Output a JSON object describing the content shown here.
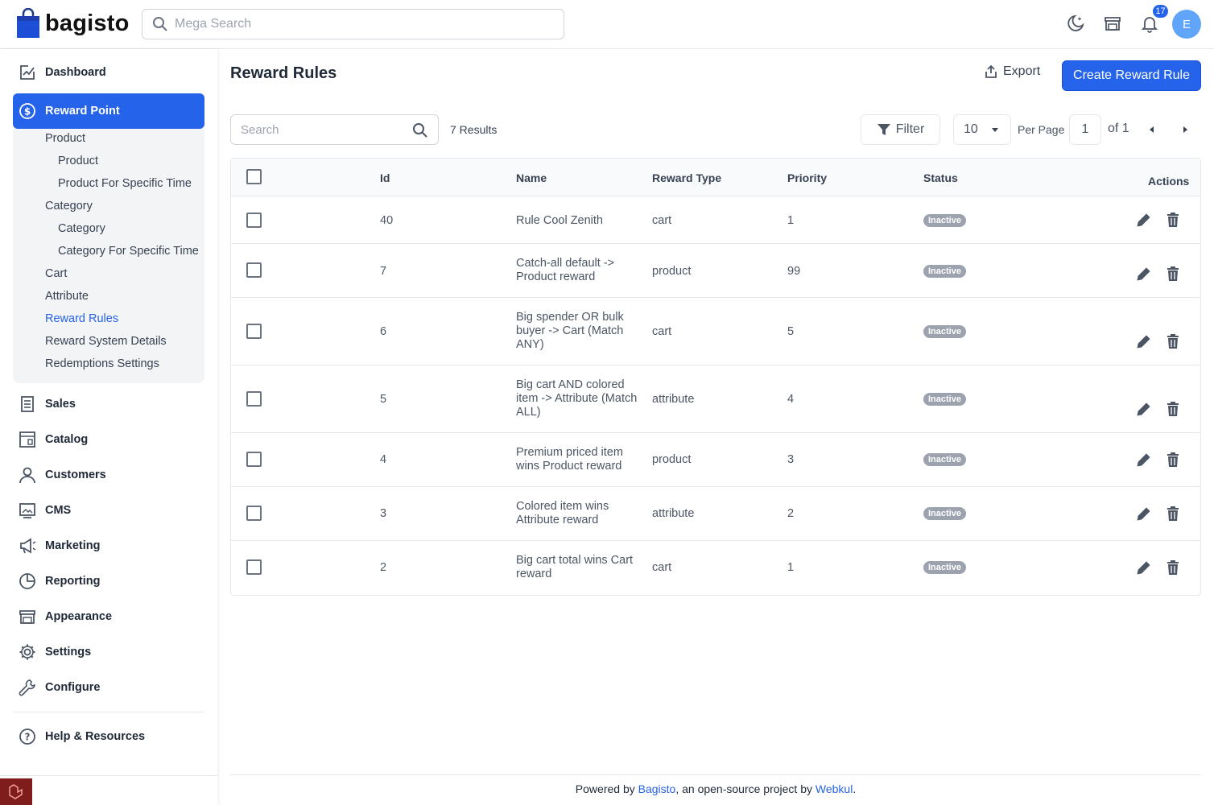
{
  "header": {
    "logo_text": "bagisto",
    "search_placeholder": "Mega Search",
    "notification_count": "17",
    "avatar_initial": "E"
  },
  "sidebar": {
    "items": [
      {
        "label": "Dashboard",
        "icon": "dashboard-icon"
      },
      {
        "label": "Reward Point",
        "icon": "dollar-circle-icon"
      },
      {
        "label": "Sales",
        "icon": "sales-icon"
      },
      {
        "label": "Catalog",
        "icon": "catalog-icon"
      },
      {
        "label": "Customers",
        "icon": "customers-icon"
      },
      {
        "label": "CMS",
        "icon": "cms-icon"
      },
      {
        "label": "Marketing",
        "icon": "megaphone-icon"
      },
      {
        "label": "Reporting",
        "icon": "pie-chart-icon"
      },
      {
        "label": "Appearance",
        "icon": "store-icon"
      },
      {
        "label": "Settings",
        "icon": "gear-icon"
      },
      {
        "label": "Configure",
        "icon": "wrench-icon"
      },
      {
        "label": "Help & Resources",
        "icon": "help-icon"
      }
    ],
    "submenu": [
      {
        "label": "Product"
      },
      {
        "label": "Product"
      },
      {
        "label": "Product For Specific Time"
      },
      {
        "label": "Category"
      },
      {
        "label": "Category"
      },
      {
        "label": "Category For Specific Time"
      },
      {
        "label": "Cart"
      },
      {
        "label": "Attribute"
      },
      {
        "label": "Reward Rules"
      },
      {
        "label": "Reward System Details"
      },
      {
        "label": "Redemptions Settings"
      }
    ]
  },
  "main": {
    "title": "Reward Rules",
    "export_label": "Export",
    "create_label": "Create Reward Rule",
    "search_placeholder": "Search",
    "results_text": "7 Results",
    "filter_label": "Filter",
    "per_page_value": "10",
    "per_page_label": "Per Page",
    "page_value": "1",
    "page_of": "of 1"
  },
  "table": {
    "headers": {
      "id": "Id",
      "name": "Name",
      "reward_type": "Reward Type",
      "priority": "Priority",
      "status": "Status",
      "actions": "Actions"
    },
    "rows": [
      {
        "id": "40",
        "name": "Rule Cool Zenith",
        "reward_type": "cart",
        "priority": "1",
        "status": "Inactive"
      },
      {
        "id": "7",
        "name": "Catch-all default -> Product reward",
        "reward_type": "product",
        "priority": "99",
        "status": "Inactive"
      },
      {
        "id": "6",
        "name": "Big spender OR bulk buyer -> Cart (Match ANY)",
        "reward_type": "cart",
        "priority": "5",
        "status": "Inactive"
      },
      {
        "id": "5",
        "name": "Big cart AND colored item -> Attribute (Match ALL)",
        "reward_type": "attribute",
        "priority": "4",
        "status": "Inactive"
      },
      {
        "id": "4",
        "name": "Premium priced item wins Product reward",
        "reward_type": "product",
        "priority": "3",
        "status": "Inactive"
      },
      {
        "id": "3",
        "name": "Colored item wins Attribute reward",
        "reward_type": "attribute",
        "priority": "2",
        "status": "Inactive"
      },
      {
        "id": "2",
        "name": "Big cart total wins Cart reward",
        "reward_type": "cart",
        "priority": "1",
        "status": "Inactive"
      }
    ]
  },
  "footer": {
    "prefix": "Powered by ",
    "link1": "Bagisto",
    "middle": ", an open-source project by ",
    "link2": "Webkul",
    "suffix": "."
  },
  "colors": {
    "primary": "#2563eb",
    "inactive_badge": "#9ca3af"
  }
}
